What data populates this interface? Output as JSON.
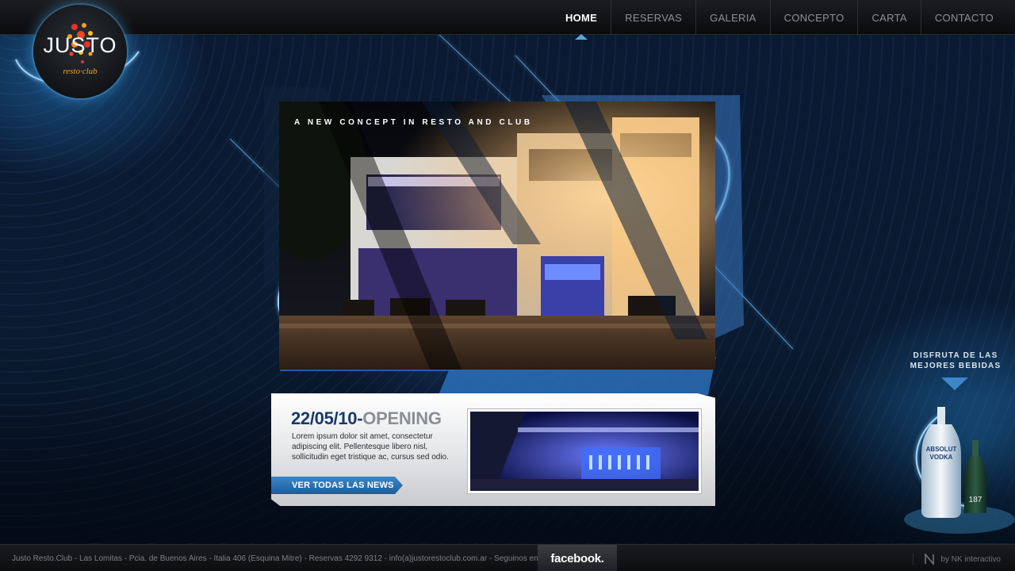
{
  "nav": {
    "items": [
      {
        "label": "HOME",
        "active": true
      },
      {
        "label": "RESERVAS",
        "active": false
      },
      {
        "label": "GALERIA",
        "active": false
      },
      {
        "label": "CONCEPTO",
        "active": false
      },
      {
        "label": "CARTA",
        "active": false
      },
      {
        "label": "CONTACTO",
        "active": false
      }
    ]
  },
  "logo": {
    "text": "JUSTO",
    "subtitle": "resto·club"
  },
  "hero": {
    "tagline": "A NEW CONCEPT IN RESTO AND CLUB"
  },
  "news": {
    "date": "22/05/10-",
    "headline": "OPENING",
    "body": "Lorem ipsum dolor sit amet, consectetur adipiscing elit. Pellentesque libero nisl, sollicitudin eget tristique ac, cursus sed odio.",
    "button_label": "VER TODAS LAS NEWS"
  },
  "promo": {
    "title_line1": "DISFRUTA DE LAS",
    "title_line2": "MEJORES  BEBIDAS",
    "bottle_label_1": "ABSOLUT",
    "bottle_label_2": "VODKA",
    "bottle_label_3": "187"
  },
  "footer": {
    "text": "Justo Resto.Club - Las Lomitas - Pcia. de Buenos Aires - Italia 406 (Esquina Mitre) - Reservas 4292 9312 - info(a)justorestoclub.com.ar - Seguinos en",
    "facebook": "facebook.",
    "credit": "by NK interactivo"
  },
  "colors": {
    "accent": "#3c87c9",
    "brand_orange": "#f0a23b",
    "nav_active": "#ffffff",
    "nav_inactive": "#8c9097"
  }
}
